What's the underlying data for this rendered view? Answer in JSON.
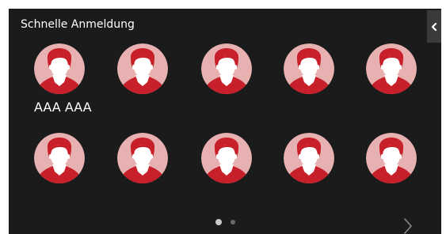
{
  "header": {
    "title": "Schnelle Anmeldung",
    "side_tab_icon": "chevron-left-icon"
  },
  "users": [
    {
      "name": "AAA AAA",
      "icon": "user-avatar-icon"
    },
    {
      "name": "",
      "icon": "user-avatar-icon"
    },
    {
      "name": "",
      "icon": "user-avatar-icon"
    },
    {
      "name": "",
      "icon": "user-avatar-icon"
    },
    {
      "name": "",
      "icon": "user-avatar-icon"
    },
    {
      "name": "",
      "icon": "user-avatar-icon"
    },
    {
      "name": "",
      "icon": "user-avatar-icon"
    },
    {
      "name": "",
      "icon": "user-avatar-icon"
    },
    {
      "name": "",
      "icon": "user-avatar-icon"
    },
    {
      "name": "",
      "icon": "user-avatar-icon"
    }
  ],
  "pagination": {
    "current_page": 1,
    "total_pages": 2,
    "next_icon": "chevron-right-icon"
  },
  "colors": {
    "background": "#1b1b1b",
    "avatar_circle": "#e7b1b1",
    "avatar_hair": "#c8202a",
    "avatar_face": "#ffffff",
    "text": "#ffffff"
  }
}
